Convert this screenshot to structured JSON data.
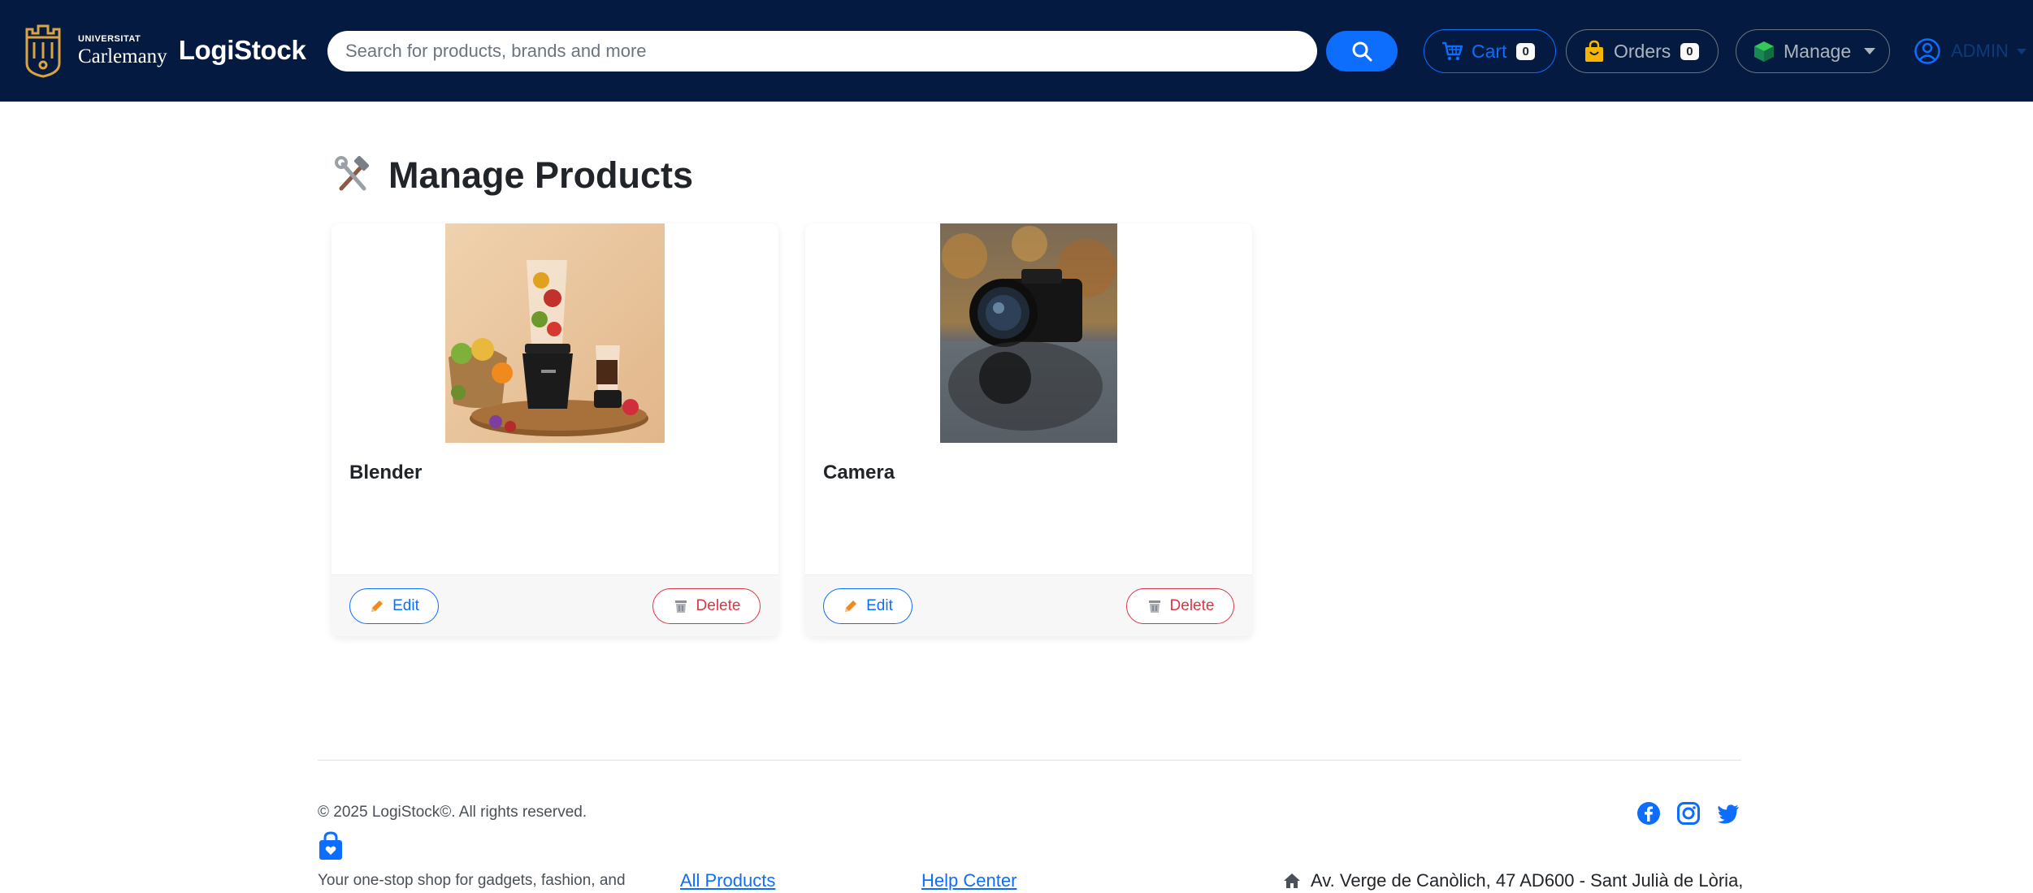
{
  "navbar": {
    "university": {
      "line1": "UNIVERSITAT",
      "line2": "Carlemany",
      "crest_icon": "university-crest-icon"
    },
    "brand_name": "LogiStock",
    "search": {
      "placeholder": "Search for products, brands and more",
      "value": "",
      "button_icon": "search-icon"
    },
    "cart": {
      "label": "Cart",
      "count": "0",
      "icon": "cart-icon"
    },
    "orders": {
      "label": "Orders",
      "count": "0",
      "icon": "shopping-bag-icon"
    },
    "manage": {
      "label": "Manage",
      "icon": "box-icon"
    },
    "user": {
      "name": "ADMIN",
      "icon": "user-circle-icon"
    }
  },
  "page": {
    "title": "Manage Products",
    "title_icon": "hammer-wrench-icon"
  },
  "products": [
    {
      "name": "Blender",
      "image": "blender-photo",
      "edit_label": "Edit",
      "delete_label": "Delete"
    },
    {
      "name": "Camera",
      "image": "camera-photo",
      "edit_label": "Edit",
      "delete_label": "Delete"
    }
  ],
  "footer": {
    "copyright": "© 2025 LogiStock©. All rights reserved.",
    "tagline": "Your one-stop shop for gadgets, fashion, and",
    "links": [
      "All Products",
      "Help Center"
    ],
    "address": "Av. Verge de Canòlich, 47 AD600 - Sant Julià de Lòria,",
    "social": [
      "facebook-icon",
      "instagram-icon",
      "twitter-icon"
    ]
  },
  "colors": {
    "navbar_bg": "#041a40",
    "primary": "#0d6efd",
    "danger": "#dc3545",
    "crest_gold": "#d9a441"
  }
}
